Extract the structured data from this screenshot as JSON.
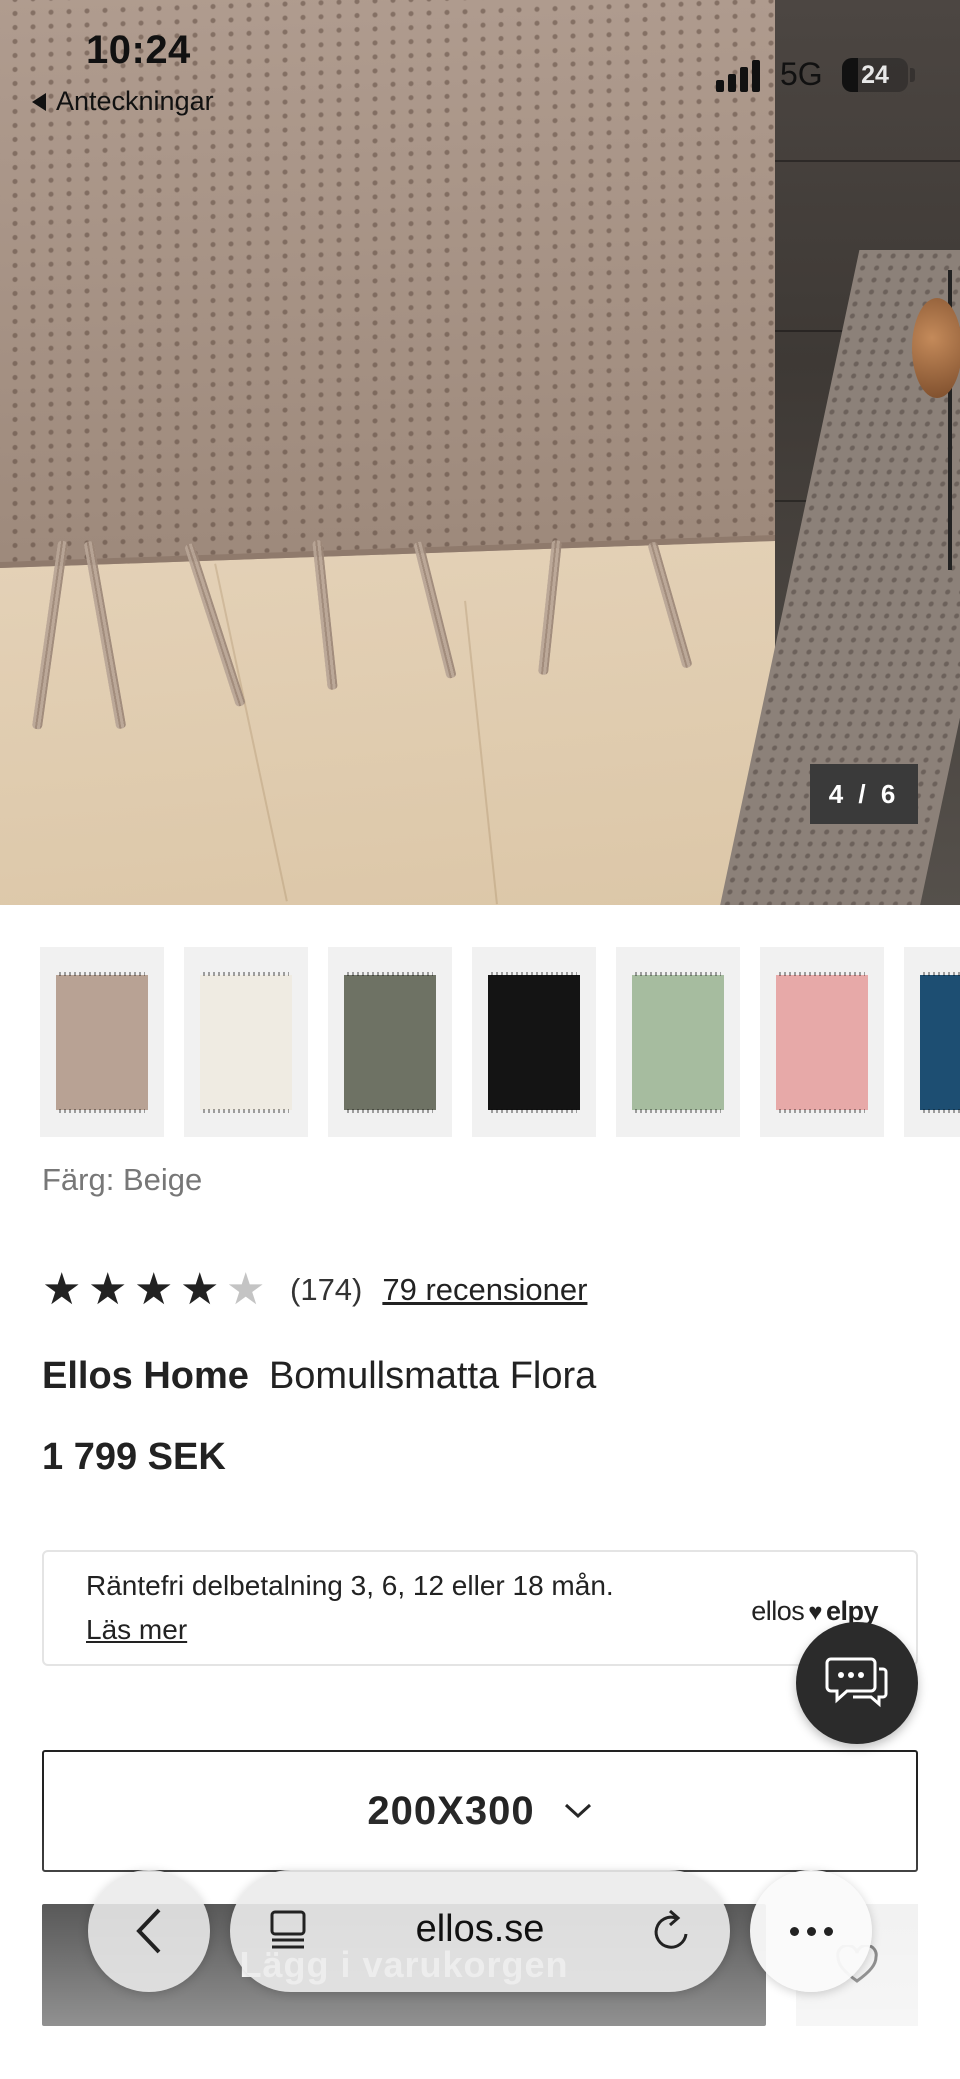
{
  "status_bar": {
    "time": "10:24",
    "back_app": "Anteckningar",
    "network": "5G",
    "battery": "24",
    "battery_level": 0.24
  },
  "gallery": {
    "counter": "4 / 6"
  },
  "swatches": {
    "colors": [
      "#b8a294",
      "#efebe2",
      "#6e7264",
      "#141414",
      "#a6bc9f",
      "#e7a9a8",
      "#1d4e72"
    ]
  },
  "product": {
    "color_label": "Färg: Beige",
    "rating_value": 4,
    "rating_max": 5,
    "rating_count": "(174)",
    "reviews_link": "79 recensioner",
    "brand": "Ellos Home",
    "name": "Bomullsmatta Flora",
    "price": "1 799 SEK"
  },
  "payment": {
    "text": "Räntefri delbetalning 3, 6, 12 eller 18 mån.",
    "link": "Läs mer",
    "logo_left": "ellos",
    "logo_right": "elpy"
  },
  "size_selector": {
    "value": "200X300"
  },
  "actions": {
    "add_to_cart": "Lägg i varukorgen"
  },
  "browser_toolbar": {
    "domain": "ellos.se"
  },
  "icons": {
    "chat": "chat-bubbles-icon",
    "chevron": "chevron-down-icon",
    "back": "chevron-left-icon",
    "tabs": "tabs-icon",
    "reload": "reload-icon",
    "more": "more-dots-icon",
    "favorite": "heart-icon"
  }
}
